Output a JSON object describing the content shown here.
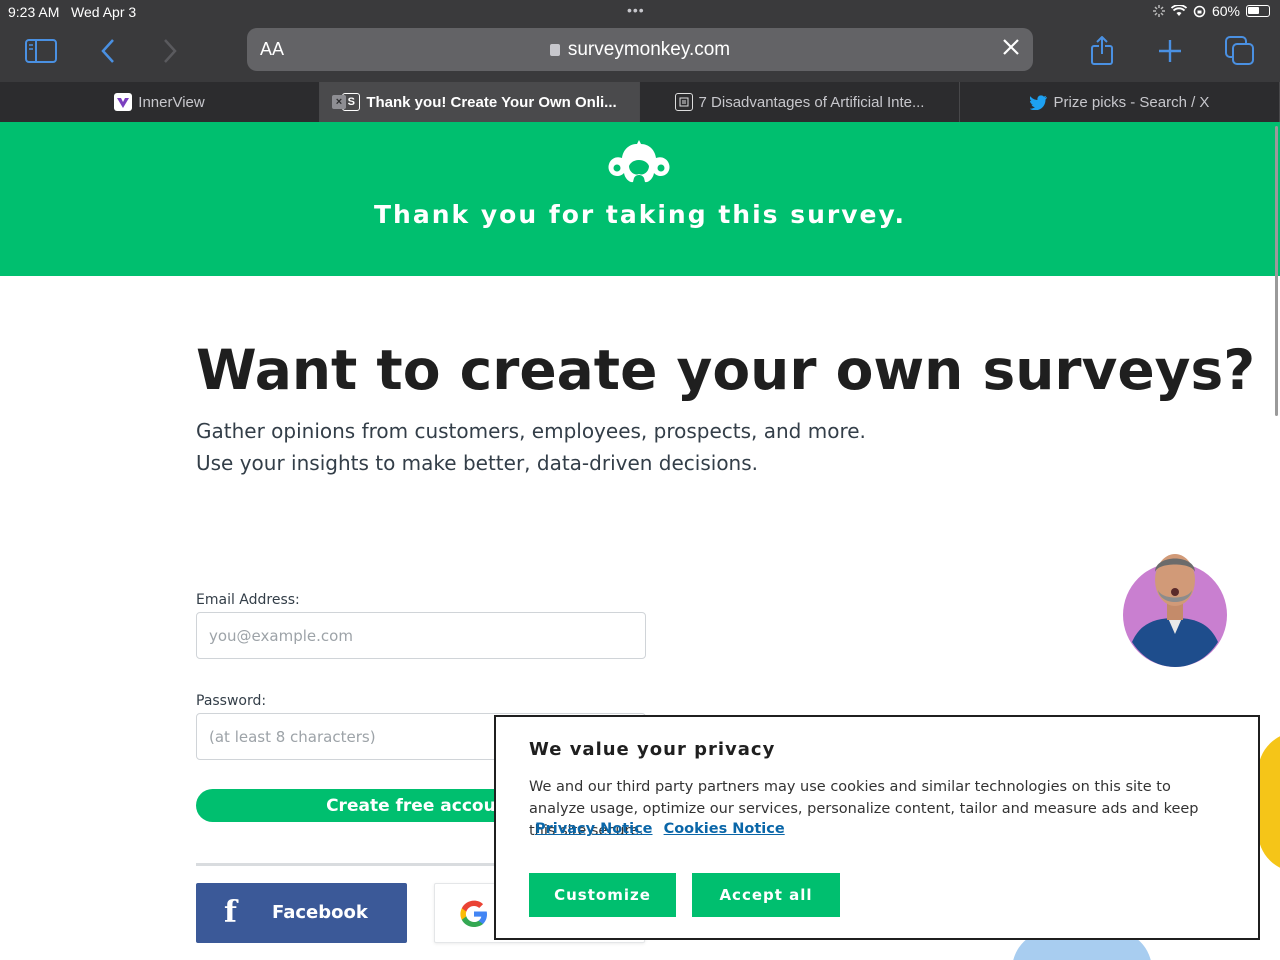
{
  "status_bar": {
    "time": "9:23 AM",
    "date": "Wed Apr 3",
    "dots": "•••",
    "battery": "60%",
    "battery_level": 0.6
  },
  "toolbar": {
    "aa": "AA",
    "url": "surveymonkey.com"
  },
  "tabs": [
    {
      "title": "InnerView",
      "active": false,
      "favicon": "innerview-icon",
      "color": "#7b3fbf"
    },
    {
      "title": "Thank you! Create Your Own Onli...",
      "active": true,
      "favicon": "surveymonkey-s-icon",
      "fav_letter": "S"
    },
    {
      "title": "7 Disadvantages of Artificial Inte...",
      "active": false,
      "favicon": "article-icon"
    },
    {
      "title": "Prize picks - Search / X",
      "active": false,
      "favicon": "twitter-bird-icon",
      "color": "#1da1f2"
    }
  ],
  "banner": {
    "thanks": "Thank you for taking this survey.",
    "color": "#00bf6f"
  },
  "main": {
    "headline": "Want to create your own surveys?",
    "sub1": "Gather opinions from customers, employees, prospects, and more.",
    "sub2": "Use your insights to make better, data-driven decisions."
  },
  "form": {
    "email_label": "Email Address:",
    "email_placeholder": "you@example.com",
    "password_label": "Password:",
    "password_placeholder": "(at least 8 characters)",
    "create_button": "Create free account"
  },
  "social": {
    "facebook_f": "f",
    "facebook": "Facebook",
    "fb_color": "#3b5998"
  },
  "privacy": {
    "title": "We value your privacy",
    "body": "We and our third party partners may use cookies and similar technologies on this site to analyze usage, optimize our services, personalize content, tailor and measure ads and keep this site secure.",
    "privacy_notice": "Privacy Notice",
    "cookies_notice": "Cookies Notice",
    "customize": "Customize",
    "accept_all": "Accept all"
  }
}
